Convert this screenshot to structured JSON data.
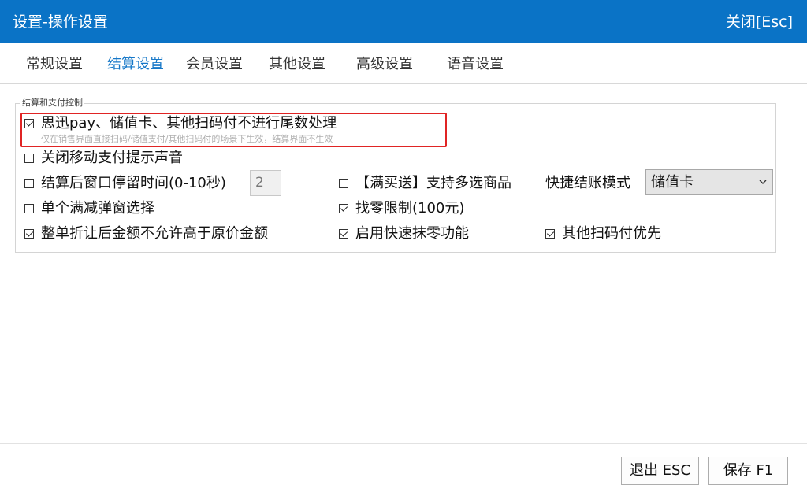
{
  "window": {
    "title": "设置-操作设置",
    "close_label": "关闭[Esc]"
  },
  "tabs": [
    {
      "label": "常规设置"
    },
    {
      "label": "结算设置",
      "active": true
    },
    {
      "label": "会员设置"
    },
    {
      "label": "其他设置"
    },
    {
      "label": "高级设置"
    },
    {
      "label": "语音设置"
    }
  ],
  "group": {
    "legend": "结算和支付控制",
    "options": {
      "tail_processing": {
        "label": "思迅pay、储值卡、其他扫码付不进行尾数处理",
        "checked": true,
        "hint": "仅在销售界面直接扫码/储值支付/其他扫码付的场景下生效，结算界面不生效"
      },
      "close_mobile_sound": {
        "label": "关闭移动支付提示声音",
        "checked": false
      },
      "stay_time": {
        "label": "结算后窗口停留时间(0-10秒)",
        "checked": false,
        "value": "2"
      },
      "buy_gift_multi": {
        "label": "【满买送】支持多选商品",
        "checked": false
      },
      "quick_checkout": {
        "label": "快捷结账模式",
        "value": "储值卡"
      },
      "single_discount_popup": {
        "label": "单个满减弹窗选择",
        "checked": false
      },
      "change_limit": {
        "label": "找零限制(100元)",
        "checked": true
      },
      "no_exceed_original": {
        "label": "整单折让后金额不允许高于原价金额",
        "checked": true
      },
      "quick_round": {
        "label": "启用快速抹零功能",
        "checked": true
      },
      "other_scan_priority": {
        "label": "其他扫码付优先",
        "checked": true
      }
    }
  },
  "footer": {
    "exit_label": "退出 ESC",
    "save_label": "保存 F1"
  },
  "colors": {
    "titlebar": "#0a73c6",
    "active_tab": "#1778c8",
    "highlight": "#e02424"
  }
}
